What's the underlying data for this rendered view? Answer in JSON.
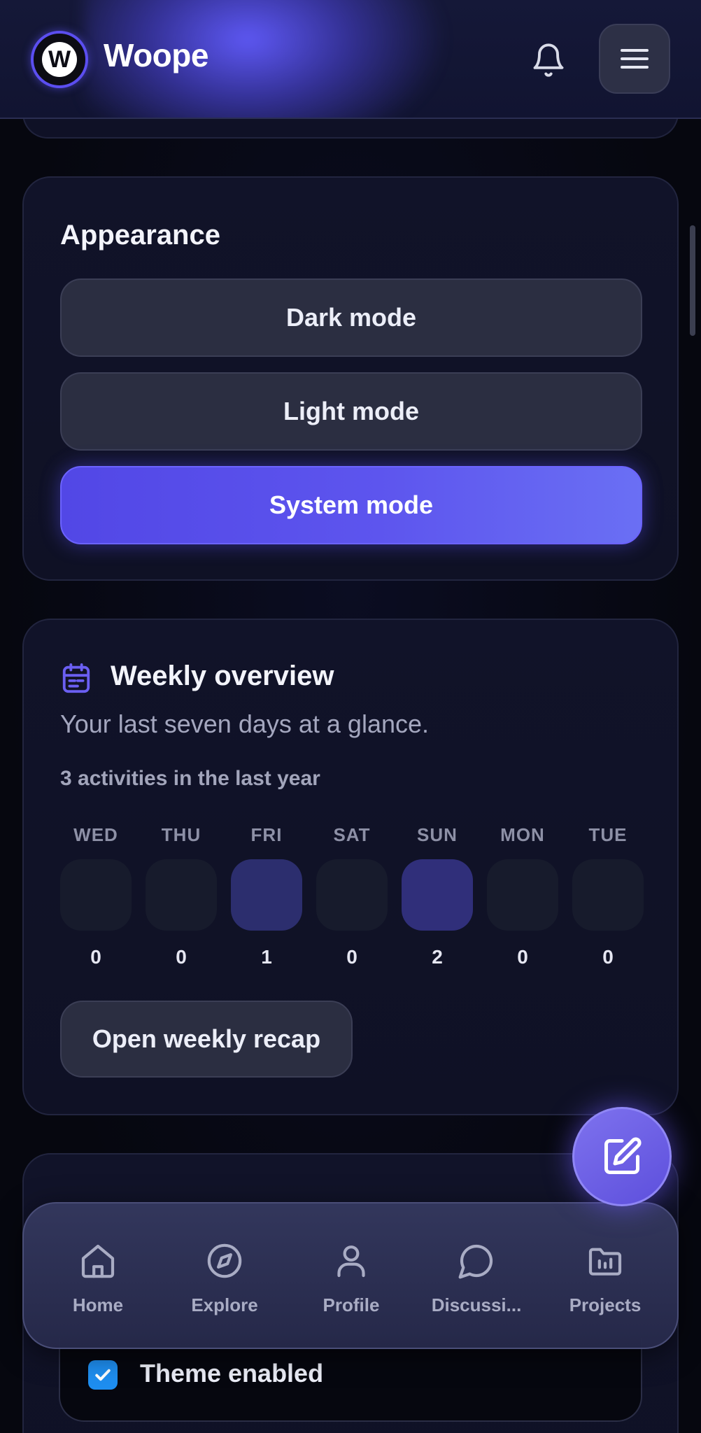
{
  "header": {
    "brand": "Woope",
    "logo_letter": "W",
    "bell_icon": "bell-icon",
    "menu_icon": "menu-icon"
  },
  "appearance": {
    "title": "Appearance",
    "options": [
      "Dark mode",
      "Light mode",
      "System mode"
    ],
    "selected": "System mode"
  },
  "weekly": {
    "title": "Weekly overview",
    "subtitle": "Your last seven days at a glance.",
    "summary": "3 activities in the last year",
    "days": [
      {
        "label": "WED",
        "count": "0"
      },
      {
        "label": "THU",
        "count": "0"
      },
      {
        "label": "FRI",
        "count": "1"
      },
      {
        "label": "SAT",
        "count": "0"
      },
      {
        "label": "SUN",
        "count": "2"
      },
      {
        "label": "MON",
        "count": "0"
      },
      {
        "label": "TUE",
        "count": "0"
      }
    ],
    "recap_button": "Open weekly recap"
  },
  "theme": {
    "checkbox_label": "Theme enabled",
    "checked": true
  },
  "nav": {
    "items": [
      {
        "label": "Home",
        "icon": "home-icon"
      },
      {
        "label": "Explore",
        "icon": "compass-icon"
      },
      {
        "label": "Profile",
        "icon": "user-icon"
      },
      {
        "label": "Discussi...",
        "icon": "chat-icon"
      },
      {
        "label": "Projects",
        "icon": "folder-icon"
      }
    ]
  },
  "fab": {
    "icon": "edit-icon"
  },
  "colors": {
    "accent": "#5b4ef0",
    "active_button": "#5d55ee",
    "background": "#070814",
    "checkbox": "#1e8ef0"
  }
}
